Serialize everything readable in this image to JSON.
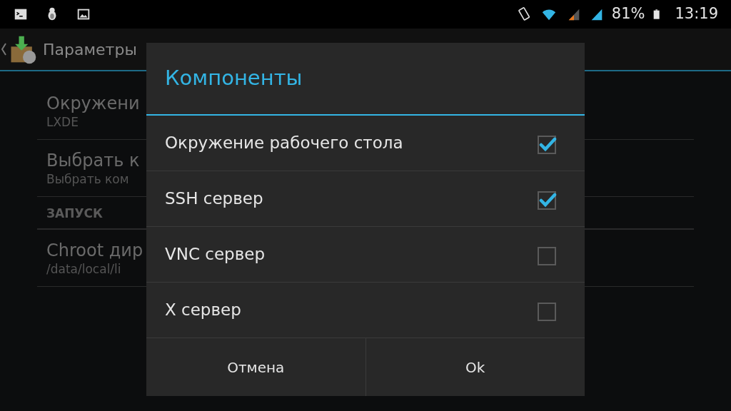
{
  "status_bar": {
    "battery": "81%",
    "time": "13:19"
  },
  "action_bar": {
    "title": "Параметры"
  },
  "settings": [
    {
      "kind": "item",
      "title": "Окружени",
      "summary": "LXDE"
    },
    {
      "kind": "item",
      "title": "Выбрать к",
      "summary": "Выбрать ком"
    },
    {
      "kind": "header",
      "title": "ЗАПУСК"
    },
    {
      "kind": "item",
      "title": "Chroot дир",
      "summary": "/data/local/li"
    }
  ],
  "dialog": {
    "title": "Компоненты",
    "options": [
      {
        "label": "Окружение рабочего стола",
        "checked": true
      },
      {
        "label": "SSH сервер",
        "checked": true
      },
      {
        "label": "VNC сервер",
        "checked": false
      },
      {
        "label": "X сервер",
        "checked": false
      }
    ],
    "buttons": [
      "Отмена",
      "Ok"
    ]
  }
}
